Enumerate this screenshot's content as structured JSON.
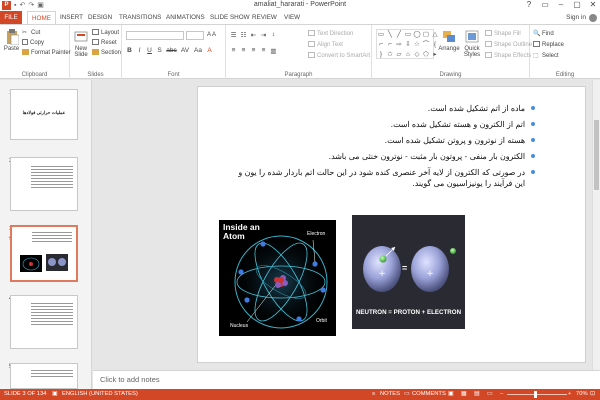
{
  "window": {
    "title": "amaliat_hararati - PowerPoint",
    "app_icon": "P",
    "qat": [
      "save-icon",
      "undo-icon",
      "redo-icon",
      "slideshow-icon"
    ],
    "controls": [
      "?",
      "▭",
      "–",
      "▢",
      "✕"
    ]
  },
  "tabs": {
    "file": "FILE",
    "items": [
      "HOME",
      "INSERT",
      "DESIGN",
      "TRANSITIONS",
      "ANIMATIONS",
      "SLIDE SHOW",
      "REVIEW",
      "VIEW"
    ],
    "active": "HOME",
    "sign_in": "Sign in"
  },
  "ribbon": {
    "clipboard": {
      "label": "Clipboard",
      "paste": "Paste",
      "cut": "Cut",
      "copy": "Copy",
      "format_painter": "Format Painter"
    },
    "slides": {
      "label": "Slides",
      "new_slide_1": "New",
      "new_slide_2": "Slide",
      "layout": "Layout",
      "reset": "Reset",
      "section": "Section"
    },
    "font": {
      "label": "Font",
      "format_buttons": [
        "B",
        "I",
        "U",
        "S",
        "abc",
        "AV",
        "Aa",
        "A"
      ]
    },
    "paragraph": {
      "label": "Paragraph",
      "text_direction": "Text Direction",
      "align_text": "Align Text",
      "convert_smartart": "Convert to SmartArt"
    },
    "drawing": {
      "label": "Drawing",
      "shapes": [
        "▭",
        "╲",
        "╱",
        "▭",
        "◯",
        "▢",
        "△",
        "⌐",
        "⌐",
        "⇨",
        "⇩",
        "☆",
        "⌒",
        "{",
        "}",
        "✩",
        "▱",
        "⌂",
        "◇",
        "⬠",
        "▸"
      ],
      "arrange": "Arrange",
      "quick_styles_1": "Quick",
      "quick_styles_2": "Styles",
      "shape_fill": "Shape Fill",
      "shape_outline": "Shape Outline",
      "shape_effects": "Shape Effects"
    },
    "editing": {
      "label": "Editing",
      "find": "Find",
      "replace": "Replace",
      "select": "Select"
    }
  },
  "thumbnails": {
    "numbers": [
      "1",
      "2",
      "3",
      "4",
      "5"
    ],
    "active_index": 2,
    "slide1_title": "عملیات حرارتی فولادها"
  },
  "slide": {
    "bullets": [
      "ماده از اتم تشکیل شده است.",
      "اتم از الکترون و هسته تشکیل شده است.",
      "هسته از نوترون و پروتن تشکیل شده است.",
      "الکترون بار منفی - پروتون بار مثبت - نوترون خنثی می باشد.",
      "در صورتی که الکترون از لایه آخر عنصری کنده شود در این حالت اتم باردار شده را یون و این فرآیند را یونیزاسیون می گویند."
    ],
    "atom_image": {
      "title_1": "Inside an",
      "title_2": "Atom",
      "label_electron": "Electron",
      "label_nucleus": "Nucleus",
      "label_orbit": "Orbit"
    },
    "neutron_image": {
      "caption": "NEUTRON = PROTON + ELECTRON",
      "equals": "="
    }
  },
  "notes": {
    "placeholder": "Click to add notes"
  },
  "status": {
    "slide_info": "SLIDE 3 OF 134",
    "language": "ENGLISH (UNITED STATES)",
    "notes_btn": "NOTES",
    "comments_btn": "COMMENTS",
    "zoom": "70%"
  },
  "colors": {
    "accent": "#d24726",
    "bullet": "#4a8ed8"
  }
}
